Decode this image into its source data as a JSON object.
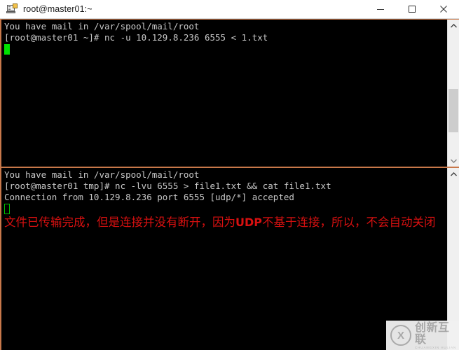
{
  "window": {
    "title": "root@master01:~",
    "icon": "putty-terminal-icon",
    "controls": {
      "minimize": "minimize-icon",
      "maximize": "maximize-icon",
      "close": "close-icon"
    }
  },
  "terminal_top": {
    "lines": [
      "You have mail in /var/spool/mail/root",
      "[root@master01 ~]# nc -u 10.129.8.236 6555 < 1.txt"
    ],
    "cursor": "filled-green-block",
    "fg_color": "#c8c8c8",
    "bg_color": "#000000",
    "cursor_color": "#00e000"
  },
  "terminal_bottom": {
    "lines": [
      "You have mail in /var/spool/mail/root",
      "[root@master01 tmp]# nc -lvu 6555 > file1.txt && cat file1.txt",
      "Connection from 10.129.8.236 port 6555 [udp/*] accepted"
    ],
    "cursor": "hollow-green-block",
    "fg_color": "#c8c8c8",
    "bg_color": "#000000"
  },
  "annotation": {
    "part1": "文件已传输完成，但是连接并没有断开，因为",
    "emphasis": "UDP",
    "part2": "不基于连接，所以，不会自动关闭",
    "color": "#d81010"
  },
  "scrollbars": {
    "top_pane": "vertical-scrollbar",
    "bottom_pane": "vertical-scrollbar",
    "up_arrow": "chevron-up-icon",
    "down_arrow": "chevron-down-icon"
  },
  "watermark": {
    "logo_letter": "X",
    "main_text": "创新互联",
    "sub_text": "CHUANGXIN HULIAN"
  }
}
